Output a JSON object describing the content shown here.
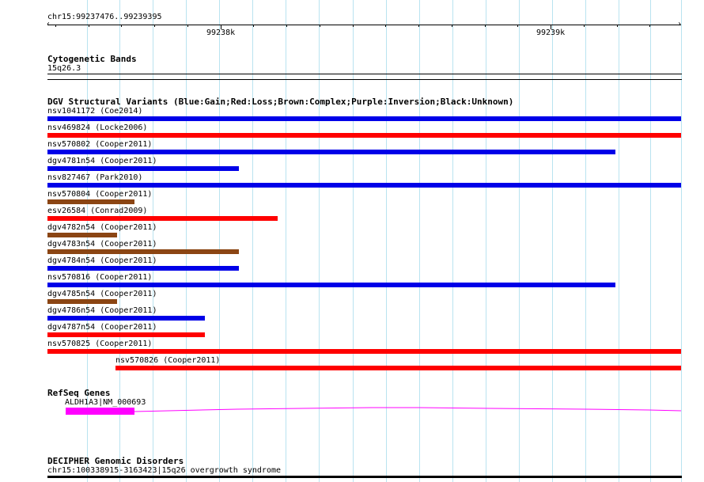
{
  "ruler": {
    "region": "chr15:99237476..99239395",
    "start": 99237476,
    "end": 99239395,
    "major_ticks": [
      {
        "label": "99238k",
        "pos": 99238000
      },
      {
        "label": "99239k",
        "pos": 99239000
      }
    ]
  },
  "cyto": {
    "title": "Cytogenetic Bands",
    "band": "15q26.3"
  },
  "dgv": {
    "title": "DGV Structural Variants (Blue:Gain;Red:Loss;Brown:Complex;Purple:Inversion;Black:Unknown)",
    "colors": {
      "gain": "#0000e8",
      "loss": "#ff0000",
      "complex": "#8b4513"
    },
    "variants": [
      {
        "label": "nsv1041172 (Coe2014)",
        "type": "gain",
        "start": 99237476,
        "end": 99239395
      },
      {
        "label": "nsv469824 (Locke2006)",
        "type": "loss",
        "start": 99237476,
        "end": 99239395
      },
      {
        "label": "nsv570802 (Cooper2011)",
        "type": "gain",
        "start": 99237476,
        "end": 99239195
      },
      {
        "label": "dgv4781n54 (Cooper2011)",
        "type": "gain",
        "start": 99237476,
        "end": 99238055
      },
      {
        "label": "nsv827467 (Park2010)",
        "type": "gain",
        "start": 99237476,
        "end": 99239395
      },
      {
        "label": "nsv570804 (Cooper2011)",
        "type": "complex",
        "start": 99237476,
        "end": 99237740
      },
      {
        "label": "esv26584 (Conrad2009)",
        "type": "loss",
        "start": 99237476,
        "end": 99238172
      },
      {
        "label": "dgv4782n54 (Cooper2011)",
        "type": "complex",
        "start": 99237476,
        "end": 99237687
      },
      {
        "label": "dgv4783n54 (Cooper2011)",
        "type": "complex",
        "start": 99237476,
        "end": 99238055
      },
      {
        "label": "dgv4784n54 (Cooper2011)",
        "type": "gain",
        "start": 99237476,
        "end": 99238055
      },
      {
        "label": "nsv570816 (Cooper2011)",
        "type": "gain",
        "start": 99237476,
        "end": 99239195
      },
      {
        "label": "dgv4785n54 (Cooper2011)",
        "type": "complex",
        "start": 99237476,
        "end": 99237687
      },
      {
        "label": "dgv4786n54 (Cooper2011)",
        "type": "gain",
        "start": 99237476,
        "end": 99237953
      },
      {
        "label": "dgv4787n54 (Cooper2011)",
        "type": "loss",
        "start": 99237476,
        "end": 99237953
      },
      {
        "label": "nsv570825 (Cooper2011)",
        "type": "loss",
        "start": 99237476,
        "end": 99239395
      },
      {
        "label": "nsv570826 (Cooper2011)",
        "type": "loss",
        "start": 99237683,
        "end": 99239395
      }
    ]
  },
  "refseq": {
    "title": "RefSeq Genes",
    "gene_label": "ALDH1A3|NM_000693",
    "color": "#ff00ff",
    "exon_start": 99237532,
    "exon_end": 99237740,
    "line_end": 99239395
  },
  "decipher": {
    "title": "DECIPHER Genomic Disorders",
    "label": "chr15:100338915-3163423|15q26 overgrowth syndrome"
  }
}
